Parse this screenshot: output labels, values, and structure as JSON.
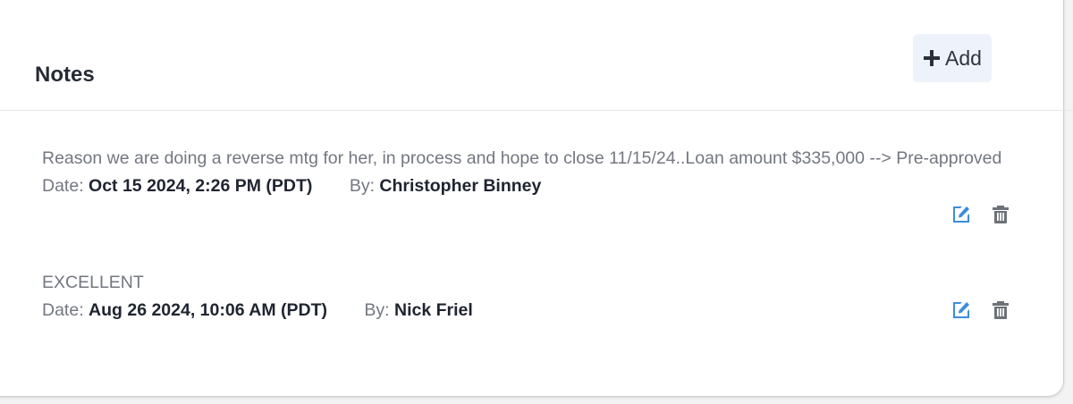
{
  "header": {
    "title": "Notes",
    "add_label": "Add"
  },
  "notes": [
    {
      "text": "Reason we are doing a reverse mtg for her, in process and hope to close 11/15/24..Loan amount $335,000 --> Pre-approved",
      "date_label": "Date:",
      "date_value": "Oct 15 2024, 2:26 PM (PDT)",
      "by_label": "By:",
      "by_value": "Christopher Binney"
    },
    {
      "text": "EXCELLENT",
      "date_label": "Date:",
      "date_value": "Aug 26 2024, 10:06 AM (PDT)",
      "by_label": "By:",
      "by_value": "Nick Friel"
    }
  ],
  "icons": {
    "add": "plus-icon",
    "edit": "edit-icon",
    "delete": "trash-icon"
  },
  "colors": {
    "accent": "#3b8ddd",
    "add_button_bg": "#eef3fb",
    "muted_text": "#737780",
    "strong_text": "#1f2430",
    "trash": "#6d7179"
  }
}
